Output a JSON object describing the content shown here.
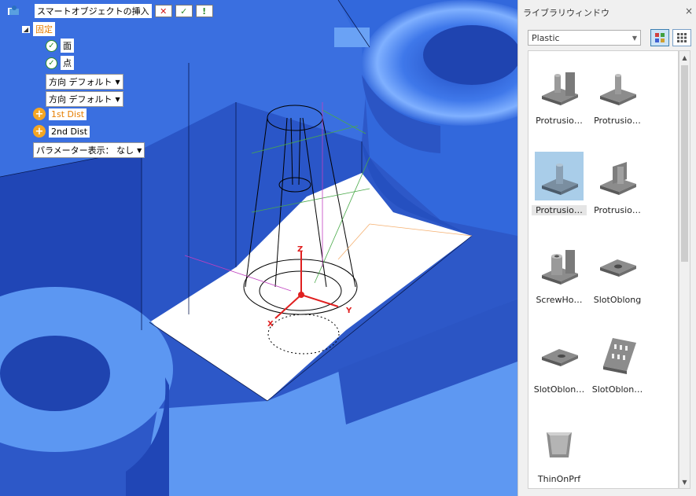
{
  "command": {
    "title": "スマートオブジェクトの挿入",
    "cancel_glyph": "✕",
    "ok_glyph": "✓",
    "info_glyph": "!"
  },
  "tree": {
    "fixed_label": "固定",
    "face_label": "面",
    "point_label": "点",
    "direction1_label": "方向 デフォルト",
    "direction2_label": "方向 デフォルト",
    "dist1_label": "1st Dist",
    "dist2_label": "2nd Dist",
    "param_display_label": "パラメーター表示： なし"
  },
  "viewport_labels": {
    "z_axis": "Z",
    "y_axis": "Y",
    "x_axis": "X"
  },
  "library": {
    "title": "ライブラリウィンドウ",
    "close_glyph": "×",
    "category": "Plastic",
    "items": [
      {
        "label": "Protrusio…",
        "icon": "protrusion-wall-icon"
      },
      {
        "label": "Protrusio…",
        "icon": "protrusion-boss-icon"
      },
      {
        "label": "Protrusio…",
        "icon": "protrusion-boss-selected-icon"
      },
      {
        "label": "Protrusio…",
        "icon": "protrusion-rib-icon"
      },
      {
        "label": "ScrewHo…",
        "icon": "screw-hole-icon"
      },
      {
        "label": "SlotOblong",
        "icon": "slot-oblong-icon"
      },
      {
        "label": "SlotOblon…",
        "icon": "slot-oblong-single-icon"
      },
      {
        "label": "SlotOblon…",
        "icon": "slot-oblong-array-icon"
      },
      {
        "label": "ThinOnPrf",
        "icon": "thin-on-profile-icon"
      }
    ]
  },
  "colors": {
    "model_blue": "#3a6fe0",
    "model_dark": "#1f45b0",
    "model_light": "#6fa3f5",
    "wire_green": "#4aaa4a",
    "wire_magenta": "#c040c0",
    "axis_red": "#e02020",
    "accent_orange": "#f5a623"
  }
}
